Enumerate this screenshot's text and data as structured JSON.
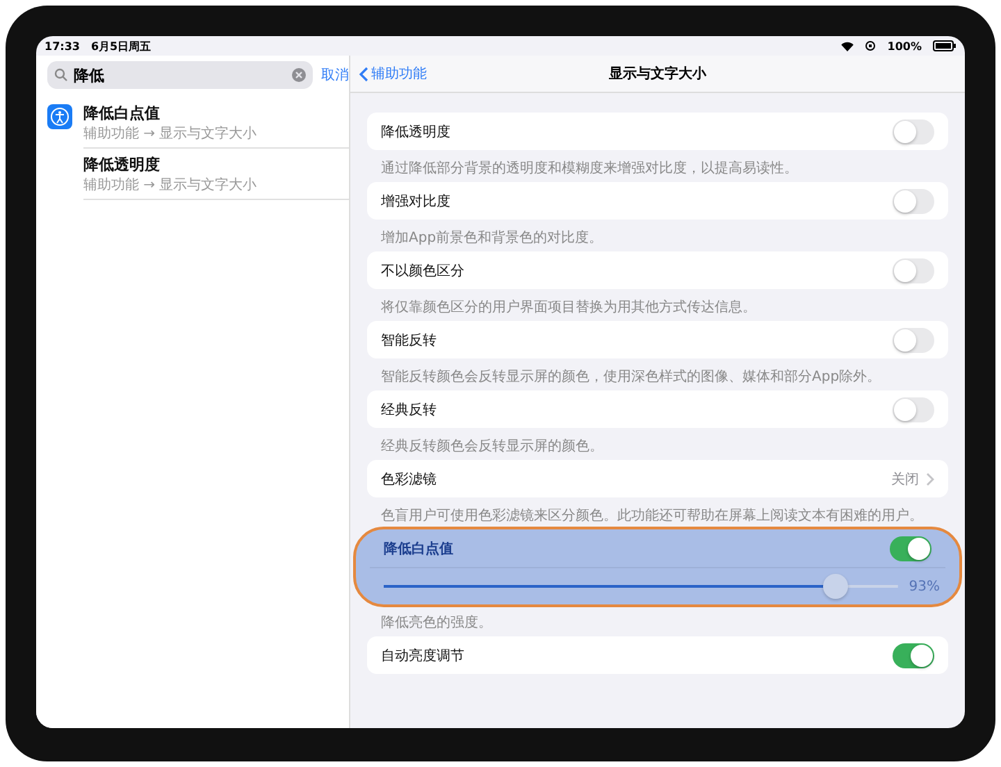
{
  "status_bar": {
    "time": "17:33",
    "date": "6月5日周五",
    "battery": "100%"
  },
  "sidebar": {
    "search": {
      "value": "降低",
      "cancel": "取消"
    },
    "results": [
      {
        "title": "降低白点值",
        "path": "辅助功能 → 显示与文字大小",
        "icon": true
      },
      {
        "title": "降低透明度",
        "path": "辅助功能 → 显示与文字大小",
        "icon": false
      }
    ]
  },
  "detail": {
    "back": "辅助功能",
    "title": "显示与文字大小",
    "groups": [
      {
        "kind": "toggle",
        "label": "降低透明度",
        "on": false,
        "footer": "通过降低部分背景的透明度和模糊度来增强对比度，以提高易读性。",
        "highlighted": false
      },
      {
        "kind": "toggle",
        "label": "增强对比度",
        "on": false,
        "footer": "增加App前景色和背景色的对比度。",
        "highlighted": false
      },
      {
        "kind": "toggle",
        "label": "不以颜色区分",
        "on": false,
        "footer": "将仅靠颜色区分的用户界面项目替换为用其他方式传达信息。",
        "highlighted": false
      },
      {
        "kind": "toggle",
        "label": "智能反转",
        "on": false,
        "footer": "智能反转颜色会反转显示屏的颜色，使用深色样式的图像、媒体和部分App除外。",
        "highlighted": false
      },
      {
        "kind": "toggle",
        "label": "经典反转",
        "on": false,
        "footer": "经典反转颜色会反转显示屏的颜色。",
        "highlighted": false
      },
      {
        "kind": "link",
        "label": "色彩滤镜",
        "value": "关闭",
        "footer": "色盲用户可使用色彩滤镜来区分颜色。此功能还可帮助在屏幕上阅读文本有困难的用户。",
        "highlighted": false
      },
      {
        "kind": "slider",
        "label": "降低白点值",
        "on": true,
        "level": 0.88,
        "reading": "93%",
        "footer": "降低亮色的强度。",
        "highlighted": true
      },
      {
        "kind": "toggle",
        "label": "自动亮度调节",
        "on": true,
        "highlighted": false
      }
    ]
  }
}
